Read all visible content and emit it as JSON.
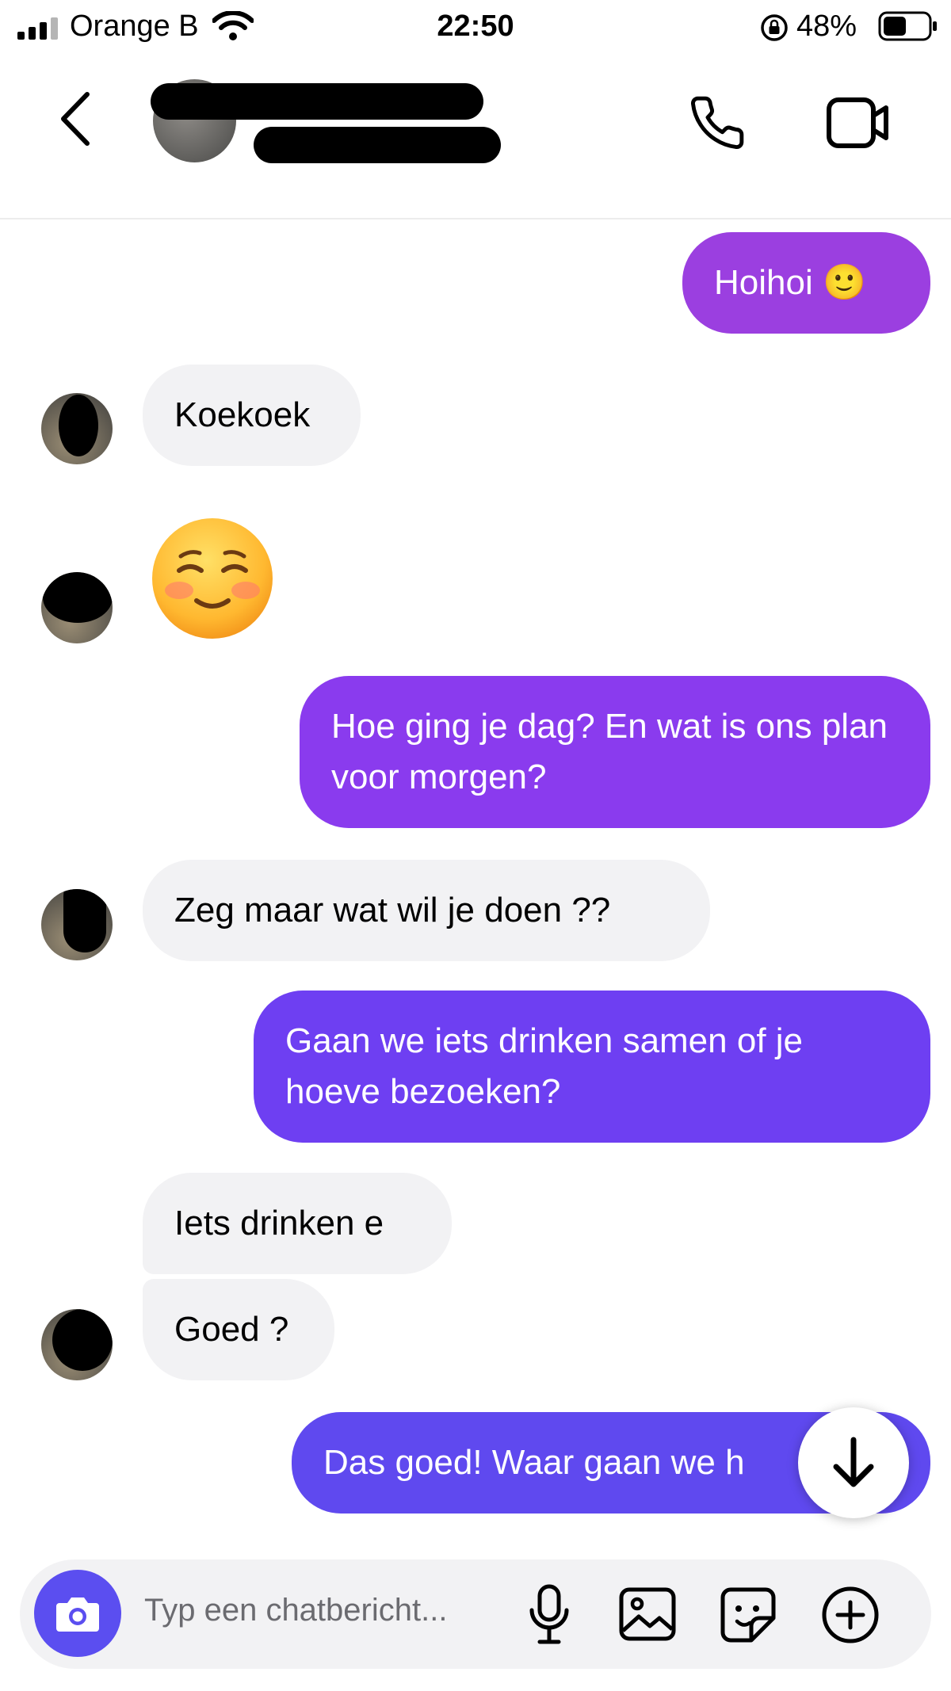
{
  "status_bar": {
    "carrier": "Orange B",
    "time": "22:50",
    "battery_percent": "48%"
  },
  "header": {
    "icons": [
      "chevron-left-icon",
      "phone-icon",
      "video-camera-icon"
    ]
  },
  "messages": [
    {
      "direction": "outgoing",
      "text": "Hoihoi 🙂",
      "color": "#9b3fe0"
    },
    {
      "direction": "incoming",
      "text": "Koekoek"
    },
    {
      "direction": "incoming",
      "text": "☺️",
      "type": "emoji"
    },
    {
      "direction": "outgoing",
      "text": "Hoe ging je dag? En wat is ons plan voor morgen?",
      "color": "#8a3bee"
    },
    {
      "direction": "incoming",
      "text": "Zeg maar wat wil je doen ??"
    },
    {
      "direction": "outgoing",
      "text": "Gaan we iets drinken samen of je hoeve bezoeken?",
      "color": "#6e3ff2"
    },
    {
      "direction": "incoming",
      "text": "Iets drinken e"
    },
    {
      "direction": "incoming",
      "text": "Goed ?"
    },
    {
      "direction": "outgoing",
      "text": "Das goed! Waar gaan we h",
      "color": "#5f49ef"
    }
  ],
  "composer": {
    "placeholder": "Typ een chatbericht...",
    "camera_color": "#5b4ef0",
    "icons": [
      "camera-icon",
      "microphone-icon",
      "image-icon",
      "sticker-icon",
      "plus-circle-icon"
    ]
  },
  "scroll_button_icon": "arrow-down-icon"
}
